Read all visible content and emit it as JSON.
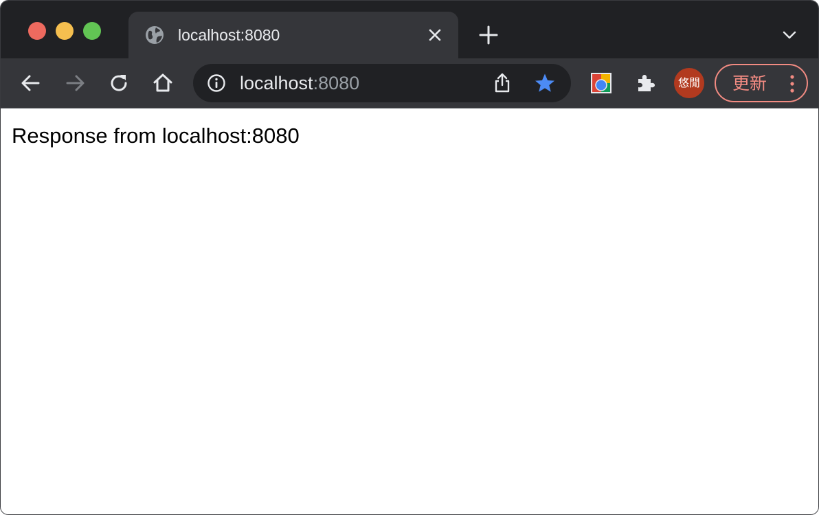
{
  "window": {
    "controls": [
      "close",
      "minimize",
      "zoom"
    ],
    "colors": {
      "close": "#ee6a5f",
      "minimize": "#f5bf4f",
      "zoom": "#62c554"
    }
  },
  "tabs": [
    {
      "title": "localhost:8080",
      "favicon": "globe-icon",
      "active": true
    }
  ],
  "toolbar": {
    "back": "arrow-left-icon",
    "forward": "arrow-right-icon",
    "forward_enabled": false,
    "reload": "reload-icon",
    "home": "home-icon"
  },
  "omnibox": {
    "host": "localhost",
    "port": ":8080",
    "site_info": "info-icon",
    "share": "share-icon",
    "bookmark": "star-icon",
    "bookmarked": true,
    "bookmark_color": "#4c8bf5"
  },
  "extensions": {
    "items": [
      "extension-icon",
      "puzzle-icon"
    ]
  },
  "profile": {
    "avatar_text": "悠閒",
    "avatar_color": "#b23a1f"
  },
  "update": {
    "label": "更新",
    "color": "#f28b82"
  },
  "page": {
    "text": "Response from localhost:8080"
  }
}
